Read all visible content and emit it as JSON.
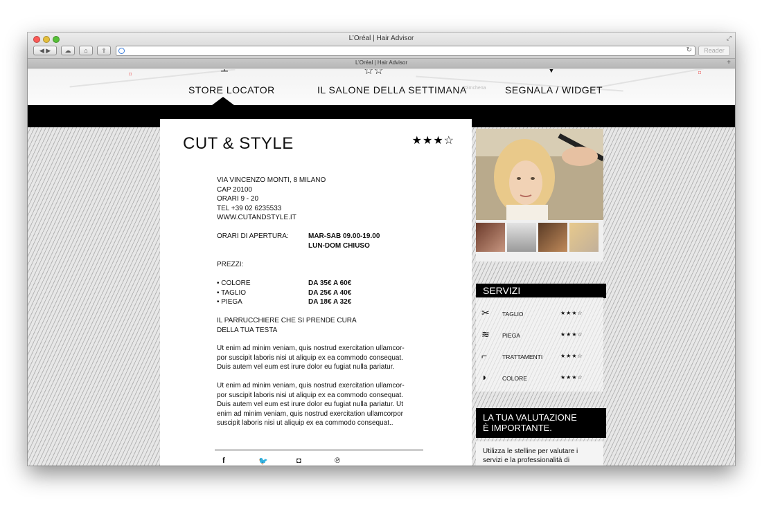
{
  "browser": {
    "window_title": "L’Oréal | Hair Advisor",
    "tab_title": "L’Oréal | Hair Advisor",
    "reader_label": "Reader"
  },
  "nav": {
    "items": [
      {
        "label": "STORE LOCATOR"
      },
      {
        "label": "IL SALONE DELLA SETTIMANA"
      },
      {
        "label": "SEGNALA / WIDGET"
      }
    ],
    "map_label": "Dimchena"
  },
  "store": {
    "name": "CUT & STYLE",
    "rating": "★★★☆",
    "address_lines": [
      "VIA VINCENZO MONTI, 8 MILANO",
      "CAP 20100",
      "ORARI  9 - 20",
      "TEL  +39 02  6235533",
      "WWW.CUTANDSTYLE.IT"
    ],
    "opening_label": "ORARI DI APERTURA:",
    "opening_values": [
      "MAR-SAB 09.00-19.00",
      "LUN-DOM CHIUSO"
    ],
    "prices_label": "PREZZI:",
    "prices": [
      {
        "label": "• COLORE",
        "value": "DA 35€ A 60€"
      },
      {
        "label": "• TAGLIO",
        "value": "DA 25€ A 40€"
      },
      {
        "label": "• PIEGA",
        "value": "DA 18€ A 32€"
      }
    ],
    "tagline_lines": [
      "IL PARRUCCHIERE CHE SI PRENDE CURA",
      "DELLA TUA TESTA"
    ],
    "paragraph1_lines": [
      "Ut enim ad minim veniam, quis nostrud exercitation ullamcor-",
      "por suscipit laboris nisi ut aliquip ex ea commodo  consequat.",
      "Duis autem vel eum est irure dolor eu fugiat nulla pariatur."
    ],
    "paragraph2_lines": [
      "Ut enim ad minim veniam, quis nostrud exercitation ullamcor-",
      "por suscipit laboris nisi ut aliquip ex ea commodo  consequat.",
      "Duis autem vel eum est irure dolor eu fugiat nulla pariatur. Ut",
      "enim ad minim veniam, quis nostrud exercitation ullamcorpor",
      "suscipit laboris nisi ut aliquip ex ea commodo  consequat.."
    ],
    "social": [
      "f",
      "🐦",
      "◘",
      "℗"
    ]
  },
  "services": {
    "title": "SERVIZI",
    "items": [
      {
        "label": "TAGLIO",
        "stars": "★★★☆",
        "icon": "scissors-icon"
      },
      {
        "label": "PIEGA",
        "stars": "★★★☆",
        "icon": "hair-wave-icon"
      },
      {
        "label": "TRATTAMENTI",
        "stars": "★★★☆",
        "icon": "hair-dryer-icon"
      },
      {
        "label": "COLORE",
        "stars": "★★★☆",
        "icon": "color-bowl-icon"
      }
    ]
  },
  "rating_box": {
    "title_lines": [
      "LA TUA VALUTAZIONE",
      "È IMPORTANTE."
    ],
    "text_lines": [
      "Utilizza le stelline per valutare i",
      "servizi e la professionalità di"
    ]
  }
}
